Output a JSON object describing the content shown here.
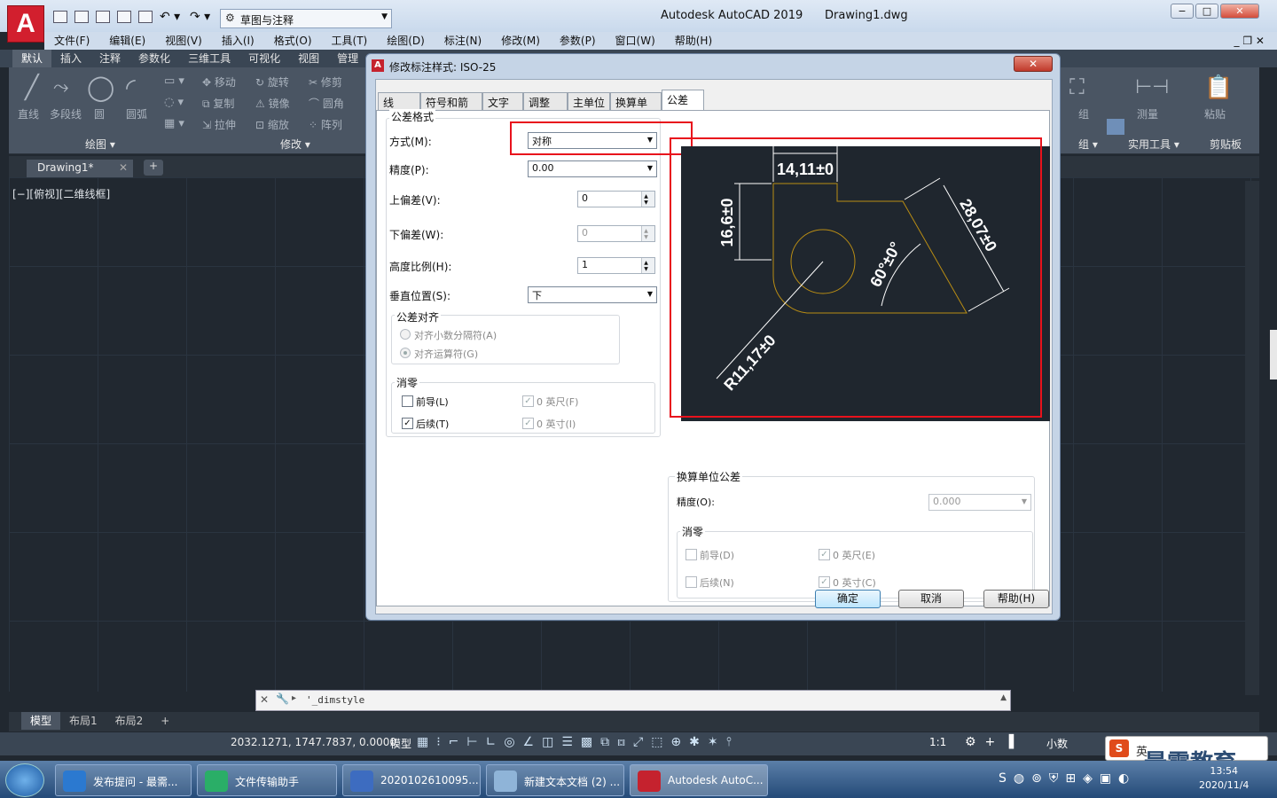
{
  "app": {
    "title": "Autodesk AutoCAD 2019",
    "file": "Drawing1.dwg",
    "logo": "A",
    "workspace": "草图与注释"
  },
  "menu": [
    "文件(F)",
    "编辑(E)",
    "视图(V)",
    "插入(I)",
    "格式(O)",
    "工具(T)",
    "绘图(D)",
    "标注(N)",
    "修改(M)",
    "参数(P)",
    "窗口(W)",
    "帮助(H)"
  ],
  "ribbon_tabs": [
    "默认",
    "插入",
    "注释",
    "参数化",
    "三维工具",
    "可视化",
    "视图",
    "管理"
  ],
  "ribbon": {
    "draw_tools": [
      "直线",
      "多段线",
      "圆",
      "圆弧"
    ],
    "modify_tools": [
      "移动",
      "旋转",
      "修剪",
      "复制",
      "镜像",
      "圆角",
      "拉伸",
      "缩放",
      "阵列"
    ],
    "draw_panel": "绘图 ▾",
    "modify_panel": "修改 ▾",
    "group_panel": "组 ▾",
    "util_panel": "实用工具 ▾",
    "clip_panel": "剪贴板",
    "group": "组",
    "measure": "测量",
    "paste": "粘贴"
  },
  "doc_tab": "Drawing1*",
  "viewport_label": "[−][俯视][二维线框]",
  "dialog": {
    "title": "修改标注样式: ISO-25",
    "close": "✕",
    "tabs": [
      "线",
      "符号和箭头",
      "文字",
      "调整",
      "主单位",
      "换算单位",
      "公差"
    ],
    "format_group": "公差格式",
    "method_label": "方式(M):",
    "method_value": "对称",
    "precision_label": "精度(P):",
    "precision_value": "0.00",
    "upper_label": "上偏差(V):",
    "upper_value": "0",
    "lower_label": "下偏差(W):",
    "lower_value": "0",
    "height_label": "高度比例(H):",
    "height_value": "1",
    "vpos_label": "垂直位置(S):",
    "vpos_value": "下",
    "align_group": "公差对齐",
    "align_decimal": "对齐小数分隔符(A)",
    "align_operator": "对齐运算符(G)",
    "zero_group": "消零",
    "leading": "前导(L)",
    "trailing": "后续(T)",
    "feet": "0 英尺(F)",
    "inches": "0 英寸(I)",
    "alt_group": "换算单位公差",
    "alt_precision_label": "精度(O):",
    "alt_precision_value": "0.000",
    "alt_zero_group": "消零",
    "alt_leading": "前导(D)",
    "alt_trailing": "后续(N)",
    "alt_feet": "0 英尺(E)",
    "alt_inches": "0 英寸(C)",
    "ok": "确定",
    "cancel": "取消",
    "help": "帮助(H)",
    "preview": {
      "dim_top": "14,11±0",
      "dim_left": "16,6±0",
      "dim_right": "28,07±0",
      "dim_angle": "60°±0°",
      "dim_radius": "R11,17±0"
    }
  },
  "command_line": "'_dimstyle",
  "layout_tabs": [
    "模型",
    "布局1",
    "布局2"
  ],
  "status": {
    "coords": "2032.1271, 1747.7837, 0.0000",
    "model": "模型",
    "scale": "1:1",
    "units": "小数"
  },
  "taskbar": [
    {
      "label": "发布提问 - 最需...",
      "icon": "ie-icon",
      "color": "#2b79d0"
    },
    {
      "label": "文件传输助手",
      "icon": "wechat-icon",
      "color": "#2aae67"
    },
    {
      "label": "2020102610095...",
      "icon": "document-icon",
      "color": "#3d6cc0"
    },
    {
      "label": "新建文本文档 (2) ...",
      "icon": "notepad-icon",
      "color": "#8fb4d8"
    },
    {
      "label": "Autodesk AutoC...",
      "icon": "autocad-icon",
      "color": "#c5222e"
    }
  ],
  "clock": {
    "time": "13:54",
    "date": "2020/11/4"
  },
  "ime": "英",
  "brand": "最需教育"
}
